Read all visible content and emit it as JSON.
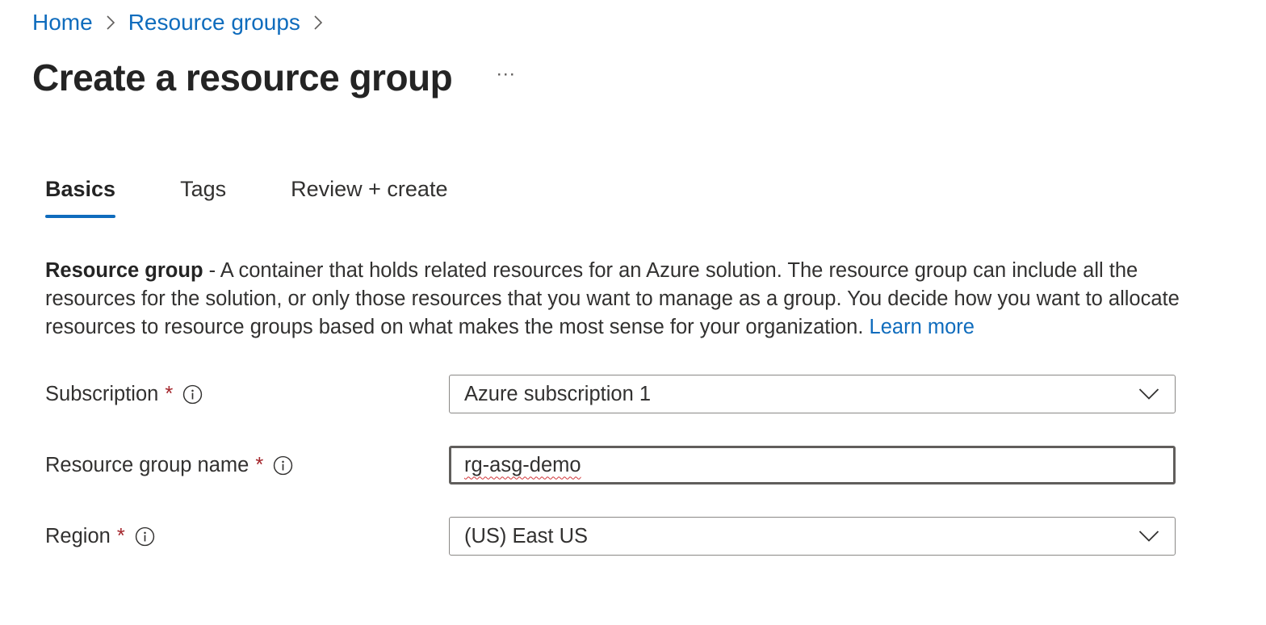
{
  "breadcrumb": {
    "items": [
      {
        "label": "Home"
      },
      {
        "label": "Resource groups"
      }
    ]
  },
  "header": {
    "title": "Create a resource group",
    "more_label": "···"
  },
  "tabs": [
    {
      "label": "Basics",
      "active": true
    },
    {
      "label": "Tags",
      "active": false
    },
    {
      "label": "Review + create",
      "active": false
    }
  ],
  "description": {
    "term": "Resource group",
    "text": " - A container that holds related resources for an Azure solution. The resource group can include all the resources for the solution, or only those resources that you want to manage as a group. You decide how you want to allocate resources to resource groups based on what makes the most sense for your organization. ",
    "link": "Learn more"
  },
  "form": {
    "subscription": {
      "label": "Subscription",
      "required": "*",
      "value": "Azure subscription 1",
      "icon": "chevron-down-icon"
    },
    "resource_group_name": {
      "label": "Resource group name",
      "required": "*",
      "value": "rg-asg-demo"
    },
    "region": {
      "label": "Region",
      "required": "*",
      "value": "(US) East US",
      "icon": "chevron-down-icon"
    }
  },
  "colors": {
    "accent": "#0f6cbd",
    "required": "#a4262c",
    "text": "#323130"
  }
}
